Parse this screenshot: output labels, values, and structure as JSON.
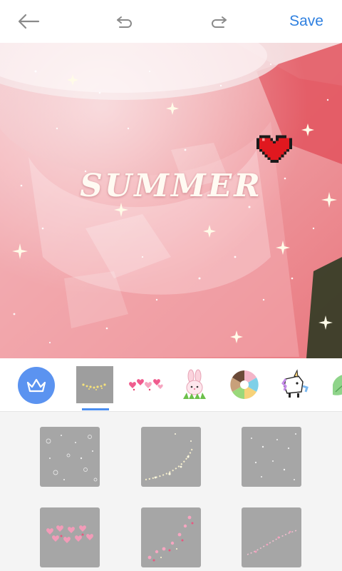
{
  "toolbar": {
    "save_label": "Save",
    "back_icon": "arrow-left-icon",
    "undo_icon": "undo-icon",
    "redo_icon": "redo-icon"
  },
  "canvas": {
    "overlay_text": "SUMMER",
    "sticker": "pixel-heart-icon"
  },
  "sticker_categories": {
    "premium_icon": "crown-icon",
    "items": [
      {
        "name": "sparkle-dust",
        "selected": true
      },
      {
        "name": "pink-hearts",
        "selected": false
      },
      {
        "name": "bunny",
        "selected": false
      },
      {
        "name": "donut-wheel",
        "selected": false
      },
      {
        "name": "unicorn",
        "selected": false
      },
      {
        "name": "leaf",
        "selected": false
      }
    ]
  },
  "sticker_grid": {
    "items": [
      "sparkle-bubbles",
      "sparkle-trail",
      "glitter-dots",
      "heart-cluster",
      "heart-swirl",
      "pink-sparkle-trail"
    ]
  },
  "colors": {
    "accent": "#2f80e0",
    "crown_bg": "#5b93f0",
    "tile_bg": "#a6a6a6",
    "grid_bg": "#f4f4f4"
  }
}
